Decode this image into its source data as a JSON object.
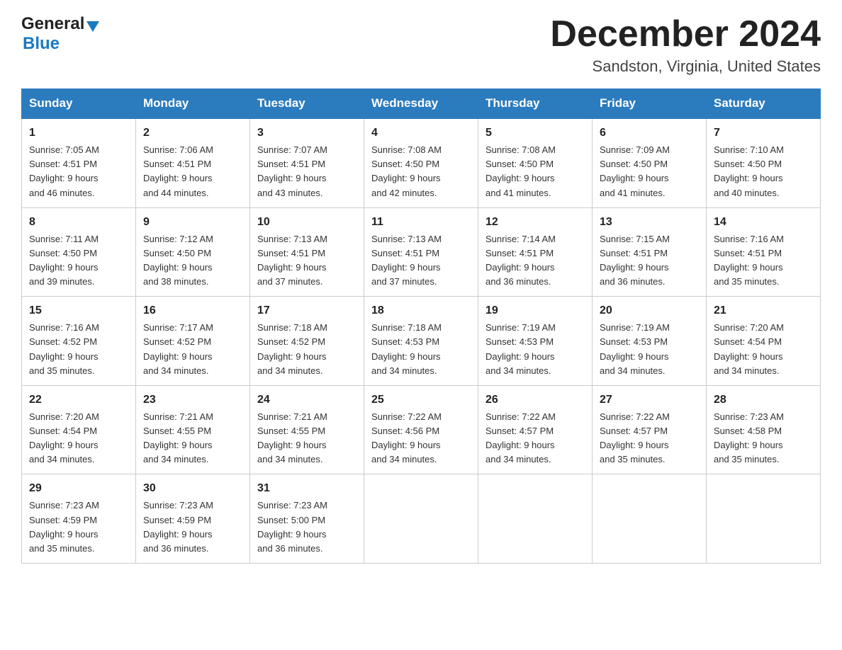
{
  "header": {
    "month_title": "December 2024",
    "location": "Sandston, Virginia, United States",
    "logo_general": "General",
    "logo_blue": "Blue"
  },
  "weekdays": [
    "Sunday",
    "Monday",
    "Tuesday",
    "Wednesday",
    "Thursday",
    "Friday",
    "Saturday"
  ],
  "weeks": [
    [
      {
        "day": "1",
        "sunrise": "7:05 AM",
        "sunset": "4:51 PM",
        "daylight": "9 hours and 46 minutes."
      },
      {
        "day": "2",
        "sunrise": "7:06 AM",
        "sunset": "4:51 PM",
        "daylight": "9 hours and 44 minutes."
      },
      {
        "day": "3",
        "sunrise": "7:07 AM",
        "sunset": "4:51 PM",
        "daylight": "9 hours and 43 minutes."
      },
      {
        "day": "4",
        "sunrise": "7:08 AM",
        "sunset": "4:50 PM",
        "daylight": "9 hours and 42 minutes."
      },
      {
        "day": "5",
        "sunrise": "7:08 AM",
        "sunset": "4:50 PM",
        "daylight": "9 hours and 41 minutes."
      },
      {
        "day": "6",
        "sunrise": "7:09 AM",
        "sunset": "4:50 PM",
        "daylight": "9 hours and 41 minutes."
      },
      {
        "day": "7",
        "sunrise": "7:10 AM",
        "sunset": "4:50 PM",
        "daylight": "9 hours and 40 minutes."
      }
    ],
    [
      {
        "day": "8",
        "sunrise": "7:11 AM",
        "sunset": "4:50 PM",
        "daylight": "9 hours and 39 minutes."
      },
      {
        "day": "9",
        "sunrise": "7:12 AM",
        "sunset": "4:50 PM",
        "daylight": "9 hours and 38 minutes."
      },
      {
        "day": "10",
        "sunrise": "7:13 AM",
        "sunset": "4:51 PM",
        "daylight": "9 hours and 37 minutes."
      },
      {
        "day": "11",
        "sunrise": "7:13 AM",
        "sunset": "4:51 PM",
        "daylight": "9 hours and 37 minutes."
      },
      {
        "day": "12",
        "sunrise": "7:14 AM",
        "sunset": "4:51 PM",
        "daylight": "9 hours and 36 minutes."
      },
      {
        "day": "13",
        "sunrise": "7:15 AM",
        "sunset": "4:51 PM",
        "daylight": "9 hours and 36 minutes."
      },
      {
        "day": "14",
        "sunrise": "7:16 AM",
        "sunset": "4:51 PM",
        "daylight": "9 hours and 35 minutes."
      }
    ],
    [
      {
        "day": "15",
        "sunrise": "7:16 AM",
        "sunset": "4:52 PM",
        "daylight": "9 hours and 35 minutes."
      },
      {
        "day": "16",
        "sunrise": "7:17 AM",
        "sunset": "4:52 PM",
        "daylight": "9 hours and 34 minutes."
      },
      {
        "day": "17",
        "sunrise": "7:18 AM",
        "sunset": "4:52 PM",
        "daylight": "9 hours and 34 minutes."
      },
      {
        "day": "18",
        "sunrise": "7:18 AM",
        "sunset": "4:53 PM",
        "daylight": "9 hours and 34 minutes."
      },
      {
        "day": "19",
        "sunrise": "7:19 AM",
        "sunset": "4:53 PM",
        "daylight": "9 hours and 34 minutes."
      },
      {
        "day": "20",
        "sunrise": "7:19 AM",
        "sunset": "4:53 PM",
        "daylight": "9 hours and 34 minutes."
      },
      {
        "day": "21",
        "sunrise": "7:20 AM",
        "sunset": "4:54 PM",
        "daylight": "9 hours and 34 minutes."
      }
    ],
    [
      {
        "day": "22",
        "sunrise": "7:20 AM",
        "sunset": "4:54 PM",
        "daylight": "9 hours and 34 minutes."
      },
      {
        "day": "23",
        "sunrise": "7:21 AM",
        "sunset": "4:55 PM",
        "daylight": "9 hours and 34 minutes."
      },
      {
        "day": "24",
        "sunrise": "7:21 AM",
        "sunset": "4:55 PM",
        "daylight": "9 hours and 34 minutes."
      },
      {
        "day": "25",
        "sunrise": "7:22 AM",
        "sunset": "4:56 PM",
        "daylight": "9 hours and 34 minutes."
      },
      {
        "day": "26",
        "sunrise": "7:22 AM",
        "sunset": "4:57 PM",
        "daylight": "9 hours and 34 minutes."
      },
      {
        "day": "27",
        "sunrise": "7:22 AM",
        "sunset": "4:57 PM",
        "daylight": "9 hours and 35 minutes."
      },
      {
        "day": "28",
        "sunrise": "7:23 AM",
        "sunset": "4:58 PM",
        "daylight": "9 hours and 35 minutes."
      }
    ],
    [
      {
        "day": "29",
        "sunrise": "7:23 AM",
        "sunset": "4:59 PM",
        "daylight": "9 hours and 35 minutes."
      },
      {
        "day": "30",
        "sunrise": "7:23 AM",
        "sunset": "4:59 PM",
        "daylight": "9 hours and 36 minutes."
      },
      {
        "day": "31",
        "sunrise": "7:23 AM",
        "sunset": "5:00 PM",
        "daylight": "9 hours and 36 minutes."
      },
      null,
      null,
      null,
      null
    ]
  ]
}
